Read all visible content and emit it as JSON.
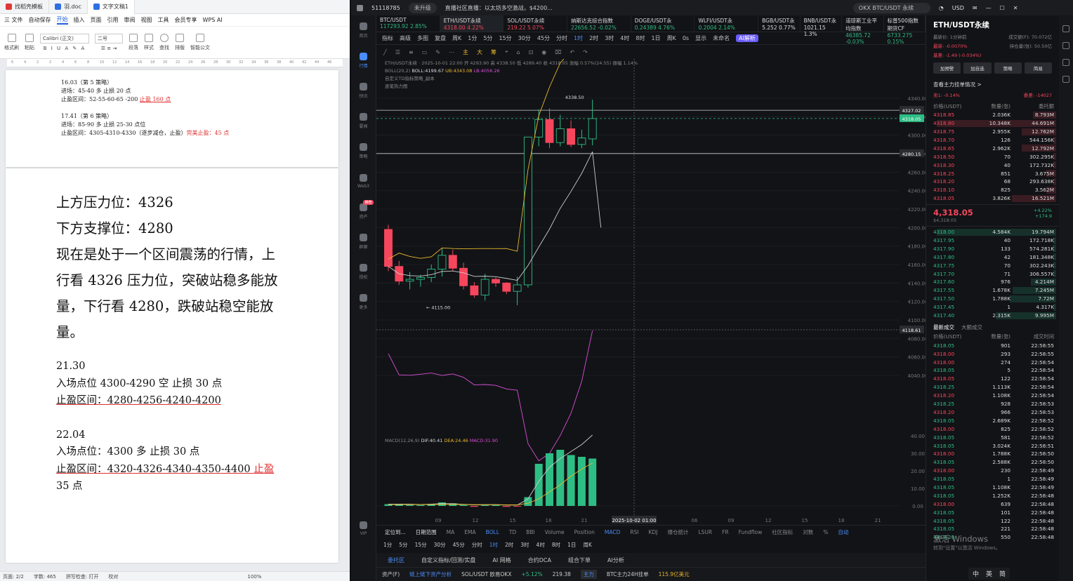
{
  "wps": {
    "tabs": [
      "找稻壳模板",
      "羽.doc",
      "文字文稿1"
    ],
    "menu": [
      "三 文件",
      "自动保存",
      "开始",
      "插入",
      "页面",
      "引用",
      "审阅",
      "视图",
      "工具",
      "会员专享",
      "WPS AI"
    ],
    "ribbon": {
      "format_brush": "格式刷",
      "paste": "粘贴",
      "font": "Calibri (正文)",
      "size": "二号",
      "paragraph": "段落",
      "style": "样式",
      "find": "查找",
      "layout": "排版",
      "smart": "智能公文"
    },
    "ruler": [
      "6",
      "4",
      "2",
      "2",
      "4",
      "6",
      "8",
      "10",
      "12",
      "14",
      "16",
      "18",
      "20",
      "22",
      "24",
      "26",
      "28",
      "30",
      "32",
      "34",
      "36",
      "38",
      "40",
      "42",
      "44",
      "46"
    ],
    "page1": {
      "b1_title": "16.03（第 5 策略）",
      "b1_entry": "进场：45-40 多 止损 20 点",
      "b1_tp_prefix": "止盈区间：52-55-60-65 -200 ",
      "b1_tp_red": "止盈 160 点",
      "b2_title": "17.41（第 6 策略）",
      "b2_entry": "进场：85-90 多 止损 25-30 点位",
      "b2_tp_prefix": "止盈区间：4305-4310-4330（逐步减仓，止盈）",
      "b2_tp_red": "完美止盈：45 点"
    },
    "page2": {
      "l1": "上方压力位：4326",
      "l2": "下方支撑位：4280",
      "l3": "现在是处于一个区间震荡的行情，上",
      "l4": "行看 4326 压力位，突破站稳多能放",
      "l5": "量，下行看 4280，跌破站稳空能放量。",
      "s1_time": "21.30",
      "s1_entry": "入场点位 4300-4290 空 止损 30 点",
      "s1_tp": "止盈区间：4280-4256-4240-4200",
      "s2_time": "22.04",
      "s2_entry": "入场点位：4300 多 止损 30 点",
      "s2_tp": "止盈区间：4320-4326-4340-4350-4400 ",
      "s2_tp_red": "止盈",
      "s2_tp_red2": "35 点"
    },
    "status": [
      "页面: 2/2",
      "字数: 465",
      "拼写检查: 打开",
      "校对",
      "100%"
    ]
  },
  "okx": {
    "window_title": "51118785",
    "badge": "未升级",
    "notice": "直播社区直播：以太坊多空激战，$4200...",
    "search": "OKX BTC/USDT 永续",
    "currency": "USD",
    "sidebar": [
      "首页",
      "行情",
      "快讯",
      "要闻",
      "策略",
      "Web3",
      "资产",
      "群聊",
      "授权",
      "更多",
      "VIP"
    ],
    "sidebar_badge": "推荐",
    "tickers": [
      {
        "n": "BTC/USDT",
        "p": "117293.92 2.85%",
        "d": "up"
      },
      {
        "n": "ETH/USDT永续",
        "p": "4318.00 4.22%",
        "d": "down"
      },
      {
        "n": "SOL/USDT永续",
        "p": "219.22 5.07%",
        "d": "down"
      },
      {
        "n": "纳斯达克综合指数",
        "p": "22656.52 -0.02%",
        "d": "up"
      },
      {
        "n": "DOGE/USDT永",
        "p": "0.24389 4.76%",
        "d": "up"
      },
      {
        "n": "WLFI/USDT永",
        "p": "0.2004 2.14%",
        "d": "up"
      },
      {
        "n": "BGB/USDT永",
        "p": "5.252 0.77%",
        "d": "none"
      },
      {
        "n": "BNB/USDT永",
        "p": "1021.15 1.3%",
        "d": "none"
      },
      {
        "n": "道琼斯工业平均指数",
        "p": "46385.72 -0.03%",
        "d": "up"
      },
      {
        "n": "标普500指数期货CF",
        "p": "6733.275 0.15%",
        "d": "up"
      }
    ],
    "toolbar": [
      "指标",
      "高级",
      "多图",
      "复盘",
      "周K",
      "1分",
      "5分",
      "15分",
      "30分",
      "45分",
      "分时",
      "1时",
      "2时",
      "3时",
      "4时",
      "8时",
      "1日",
      "周K",
      "0s",
      "显示",
      "未命名",
      "AI解析"
    ],
    "active_tf": "1时",
    "legend": {
      "l1": "ETH/USDT永续 · 2025-10-01 22:00 开 4293.90 高 4338.50 低 4289.40 收 4318.05 涨幅 0.57%(24.55) 振幅 1.14%",
      "boll": "BOLL(20,2)",
      "boll_v": "BOLL:4199.67",
      "ub": "UB:4343.08",
      "lb": "LB:4056.26",
      "l3": "自定义TD指标策略_副本",
      "l4": "逐笔热力图"
    },
    "macd": {
      "label": "MACD(12,26,9)",
      "dif": "DIF:40.41",
      "dea": "DEA:24.46",
      "macd": "MACD:31.90"
    },
    "axis": {
      "price_ticks": [
        "4340.00",
        "4320.00",
        "4300.00",
        "4280.00",
        "4260.00",
        "4240.00",
        "4220.00",
        "4200.00",
        "4180.00",
        "4160.00",
        "4140.00",
        "4120.00",
        "4100.00",
        "4080.00",
        "4060.00",
        "4040.00"
      ],
      "macd_ticks": [
        "40.00",
        "30.00",
        "20.00",
        "10.00",
        "0.00"
      ],
      "x_ticks": [
        "09",
        "12",
        "15",
        "18",
        "21",
        "2025-10-02 01:00",
        "06",
        "09",
        "12",
        "15",
        "18",
        "21"
      ],
      "label_4327": "4327.02",
      "label_last": "4318.05",
      "label_4280": "4280.15",
      "label_cross": "4118.61",
      "hi": "4338.50",
      "lo": "4115.00"
    },
    "chart_data": {
      "type": "candlestick",
      "hlines": [
        4327.02,
        4280.15
      ],
      "candles": [
        [
          4198,
          4203,
          4153,
          4158
        ],
        [
          4158,
          4164,
          4138,
          4142
        ],
        [
          4142,
          4152,
          4133,
          4144
        ],
        [
          4144,
          4149,
          4136,
          4146
        ],
        [
          4146,
          4160,
          4141,
          4155
        ],
        [
          4155,
          4178,
          4147,
          4170
        ],
        [
          4170,
          4176,
          4153,
          4156
        ],
        [
          4156,
          4162,
          4133,
          4137
        ],
        [
          4137,
          4141,
          4124,
          4127
        ],
        [
          4127,
          4150,
          4121,
          4144
        ],
        [
          4144,
          4146,
          4136,
          4140
        ],
        [
          4140,
          4141,
          4128,
          4131
        ],
        [
          4131,
          4147,
          4116,
          4138
        ],
        [
          4138,
          4227,
          4135,
          4298
        ],
        [
          4298,
          4328,
          4288,
          4317
        ],
        [
          4317,
          4329,
          4286,
          4292
        ],
        [
          4292,
          4322,
          4288,
          4307
        ],
        [
          4307,
          4316,
          4287,
          4290
        ],
        [
          4290,
          4306,
          4286,
          4297
        ],
        [
          4296,
          4338.5,
          4289,
          4318
        ]
      ]
    },
    "bottom_tabs": [
      "定位到...",
      "日期范围",
      "MA",
      "EMA",
      "BOLL",
      "TD",
      "BBI",
      "Volume",
      "Position",
      "MACD",
      "RSI",
      "KDJ",
      "爆仓统计",
      "LSUR",
      "FR",
      "Fundflow",
      "社区指标",
      "对数",
      "%",
      "自动"
    ],
    "bottom_tfs": [
      "1分",
      "5分",
      "15分",
      "30分",
      "45分",
      "分时",
      "1时",
      "2时",
      "3时",
      "4时",
      "8时",
      "1日",
      "周K"
    ],
    "panel_tabs": [
      "委托区",
      "自定义指标/回测/实盘",
      "AI 网格",
      "合约DCA",
      "组合下单",
      "AI分析"
    ],
    "footer": {
      "asset": "资产(F)",
      "link": "链上链下资产分析",
      "pair": "SOL/USDT 欧易OKX",
      "pct": "+5.12%",
      "px": "219.38",
      "tag": "主力",
      "btc": "BTC主力24H挂单",
      "val": "115.9亿美元"
    },
    "right": {
      "symbol": "ETH/USDT永续",
      "sub1": "最新价: 1分钟前",
      "sub2": "成交额(F): 70.072亿",
      "sub3": "持仓量(张): 50.50亿",
      "sub4": "基差: -1.49 (-0.034%)",
      "sub5": "最新: -0.0070%",
      "btns": [
        "加预警",
        "加自选",
        "策略",
        "简易"
      ],
      "depth_title": "查看主力挂单情况 >",
      "asks_label": "卖1: -0.14%",
      "bids_label": "委差: -14027",
      "hdr": [
        "价格(USDT)",
        "数量(张)",
        "委托额"
      ],
      "asks": [
        [
          "4318.85",
          "2.036K",
          "8.793M"
        ],
        [
          "4318.80",
          "10.348K",
          "44.691M"
        ],
        [
          "4318.75",
          "2.955K",
          "12.762M"
        ],
        [
          "4318.70",
          "126",
          "544.156K"
        ],
        [
          "4318.65",
          "2.962K",
          "12.792M"
        ],
        [
          "4318.50",
          "70",
          "302.295K"
        ],
        [
          "4318.30",
          "40",
          "172.732K"
        ],
        [
          "4318.25",
          "851",
          "3.675M"
        ],
        [
          "4318.20",
          "68",
          "293.638K"
        ],
        [
          "4318.10",
          "825",
          "3.562M"
        ],
        [
          "4318.05",
          "3.826K",
          "16.521M"
        ]
      ],
      "mid_price": "4,318.05",
      "mid_sub": "$4,318.05",
      "mid_pct": "+4.22%",
      "mid_chg": "+174.9",
      "bids": [
        [
          "4318.00",
          "4.584K",
          "19.794M"
        ],
        [
          "4317.95",
          "40",
          "172.718K"
        ],
        [
          "4317.90",
          "133",
          "574.281K"
        ],
        [
          "4317.80",
          "42",
          "181.348K"
        ],
        [
          "4317.75",
          "70",
          "302.243K"
        ],
        [
          "4317.70",
          "71",
          "306.557K"
        ],
        [
          "4317.60",
          "976",
          "4.214M"
        ],
        [
          "4317.55",
          "1.678K",
          "7.245M"
        ],
        [
          "4317.50",
          "1.788K",
          "7.72M"
        ],
        [
          "4317.45",
          "1",
          "4.317K"
        ],
        [
          "4317.40",
          "2.315K",
          "9.995M"
        ]
      ],
      "trades_tabs": [
        "最新成交",
        "大额成交"
      ],
      "thdr": [
        "价格(USDT)",
        "数量(张)",
        "成交时间"
      ],
      "trades": [
        [
          "4318.05",
          "901",
          "22:58:55",
          "g"
        ],
        [
          "4318.00",
          "293",
          "22:58:55",
          "r"
        ],
        [
          "4318.00",
          "274",
          "22:58:54",
          "r"
        ],
        [
          "4318.05",
          "5",
          "22:58:54",
          "g"
        ],
        [
          "4318.05",
          "122",
          "22:58:54",
          "r"
        ],
        [
          "4318.25",
          "1.113K",
          "22:58:54",
          "g"
        ],
        [
          "4318.20",
          "1.108K",
          "22:58:54",
          "r"
        ],
        [
          "4318.25",
          "928",
          "22:58:53",
          "g"
        ],
        [
          "4318.20",
          "966",
          "22:58:53",
          "r"
        ],
        [
          "4318.05",
          "2.689K",
          "22:58:52",
          "g"
        ],
        [
          "4318.00",
          "825",
          "22:58:52",
          "r"
        ],
        [
          "4318.05",
          "581",
          "22:58:52",
          "g"
        ],
        [
          "4318.05",
          "3.024K",
          "22:58:51",
          "g"
        ],
        [
          "4318.00",
          "1.788K",
          "22:58:50",
          "r"
        ],
        [
          "4318.05",
          "2.588K",
          "22:58:50",
          "g"
        ],
        [
          "4318.00",
          "230",
          "22:58:49",
          "r"
        ],
        [
          "4318.05",
          "1",
          "22:58:49",
          "g"
        ],
        [
          "4318.05",
          "1.108K",
          "22:58:49",
          "g"
        ],
        [
          "4318.05",
          "1.252K",
          "22:58:48",
          "g"
        ],
        [
          "4318.00",
          "639",
          "22:58:48",
          "r"
        ],
        [
          "4318.05",
          "101",
          "22:58:48",
          "g"
        ],
        [
          "4318.05",
          "122",
          "22:58:48",
          "g"
        ],
        [
          "4318.05",
          "221",
          "22:58:48",
          "g"
        ],
        [
          "4318.20",
          "550",
          "22:58:48",
          "g"
        ]
      ],
      "watermark1": "激活 Windows",
      "watermark2": "转到\"设置\"以激活 Windows。",
      "taskbar": [
        "中",
        "英",
        "简"
      ]
    }
  }
}
